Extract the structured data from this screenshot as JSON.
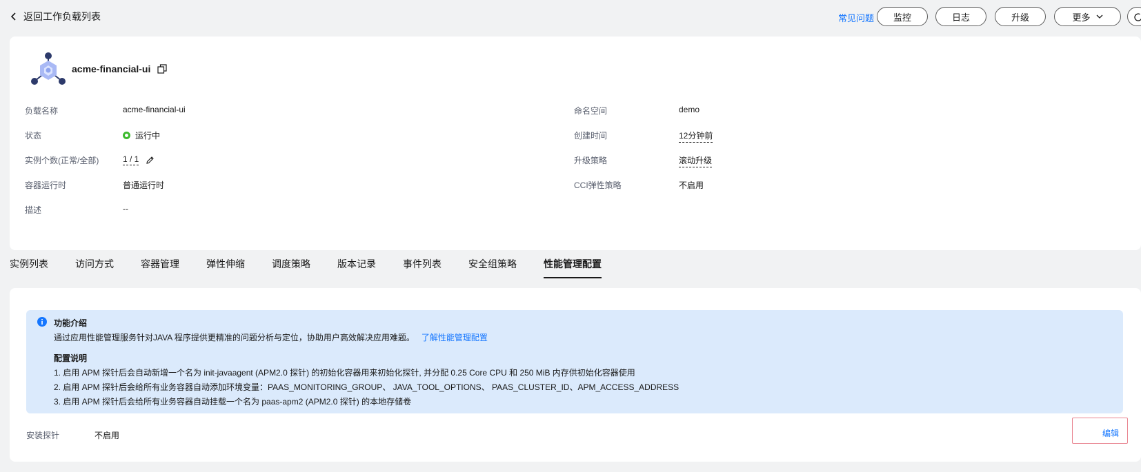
{
  "header": {
    "back_label": "返回工作负载列表",
    "faq_label": "常见问题",
    "buttons": {
      "monitor": "监控",
      "logs": "日志",
      "upgrade": "升级",
      "more": "更多"
    }
  },
  "workload": {
    "name": "acme-financial-ui",
    "fields": {
      "name_label": "负载名称",
      "name_value": "acme-financial-ui",
      "status_label": "状态",
      "status_value": "运行中",
      "instances_label": "实例个数(正常/全部)",
      "instances_value": "1 / 1",
      "runtime_label": "容器运行时",
      "runtime_value": "普通运行时",
      "desc_label": "描述",
      "desc_value": "--",
      "namespace_label": "命名空间",
      "namespace_value": "demo",
      "created_label": "创建时间",
      "created_value": "12分钟前",
      "upgrade_policy_label": "升级策略",
      "upgrade_policy_value": "滚动升级",
      "cci_label": "CCI弹性策略",
      "cci_value": "不启用"
    },
    "status_color": "#3dba2e"
  },
  "tabs": [
    {
      "label": "实例列表"
    },
    {
      "label": "访问方式"
    },
    {
      "label": "容器管理"
    },
    {
      "label": "弹性伸缩"
    },
    {
      "label": "调度策略"
    },
    {
      "label": "版本记录"
    },
    {
      "label": "事件列表"
    },
    {
      "label": "安全组策略"
    },
    {
      "label": "性能管理配置",
      "active": true
    }
  ],
  "apm": {
    "notice_title": "功能介绍",
    "notice_intro": "通过应用性能管理服务针对JAVA 程序提供更精准的问题分析与定位，协助用户高效解决应用难题。",
    "notice_link": "了解性能管理配置",
    "config_title": "配置说明",
    "lines": [
      "1. 启用 APM 探针后会自动新增一个名为 init-javaagent (APM2.0 探针) 的初始化容器用来初始化探针, 并分配 0.25 Core CPU 和 250 MiB 内存供初始化容器使用",
      "2. 启用 APM 探针后会给所有业务容器自动添加环境变量：PAAS_MONITORING_GROUP、 JAVA_TOOL_OPTIONS、 PAAS_CLUSTER_ID、APM_ACCESS_ADDRESS",
      "3. 启用 APM 探针后会给所有业务容器自动挂载一个名为 paas-apm2 (APM2.0 探针) 的本地存储卷"
    ],
    "probe_label": "安装探针",
    "probe_value": "不启用",
    "edit_label": "编辑"
  },
  "colors": {
    "accent": "#1476ff",
    "notice_bg": "#dbeafc",
    "highlight_border": "#e8818d"
  }
}
